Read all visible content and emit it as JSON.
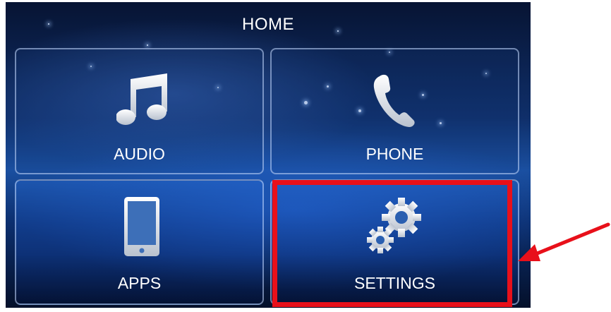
{
  "header": {
    "title": "HOME"
  },
  "tiles": [
    {
      "label": "AUDIO",
      "icon": "music-note-icon"
    },
    {
      "label": "PHONE",
      "icon": "phone-icon"
    },
    {
      "label": "APPS",
      "icon": "tablet-icon"
    },
    {
      "label": "SETTINGS",
      "icon": "gears-icon"
    }
  ],
  "annotation": {
    "highlight_color": "#e8101a",
    "arrow_color": "#e8101a"
  }
}
